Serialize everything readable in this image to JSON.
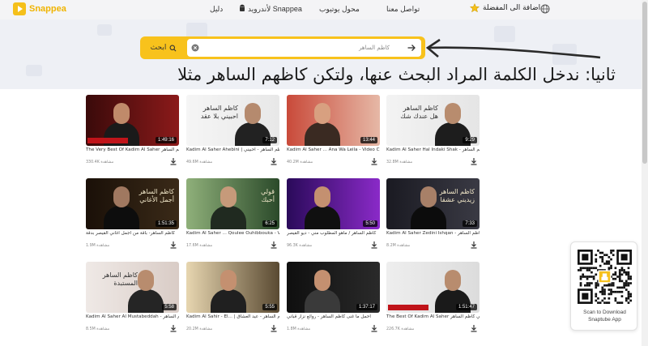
{
  "header": {
    "brand": "Snappea",
    "nav_guide": "دليل",
    "nav_android": "لأندرويد Snappea",
    "nav_converter": "محول يوتيوب",
    "nav_contact": "تواصل معنا",
    "nav_favorites": "اضافة الى المفضلة",
    "accent_color": "#f5c01b"
  },
  "search": {
    "value": "كاظم الساهر",
    "button_label": "ابحث",
    "button_icon": "search-icon",
    "clear_icon": "close-circle-icon",
    "submit_icon": "arrow-right-icon"
  },
  "annotation": "ثانيا: ندخل الكلمة المراد البحث عنها، ولتكن كاظهم الساهر مثلا",
  "videos": [
    {
      "thumb_text": "",
      "duration": "1:49:16",
      "title": "The Very Best Of Kadim Al Saher كاظم الساهر",
      "views": "330.4K مشاهدة"
    },
    {
      "thumb_text": "كاظم الساهر\nاحبيني بلا عقد",
      "duration": "7:12",
      "title": "Kadim Al Saher Ahebini | كاظم الساهر - أحبيني",
      "views": "49.6M مشاهدة"
    },
    {
      "thumb_text": "",
      "duration": "13:44",
      "title": "Kadim Al Saher ... Ana Wa Leila - Video Clip |",
      "views": "40.2M مشاهدة"
    },
    {
      "thumb_text": "كاظم الساهر\nهل عندك شك",
      "duration": "9:29",
      "title": "Kadim Al Saher Hal Indaki Shak - كاظم الساهر",
      "views": "32.8M مشاهدة"
    },
    {
      "thumb_text": "كاظم الساهر\nأجمل الأغاني",
      "duration": "1:51:35",
      "title": "كاظم الساهر- باقة من أجمل أغاني القيصر بدقة",
      "views": "1.9M مشاهدة"
    },
    {
      "thumb_text": "قولي\nأحبك",
      "duration": "6:25",
      "title": "Kadim Al Saher ... Qoulee Ouhibbouka - Vide",
      "views": "17.6M مشاهدة"
    },
    {
      "thumb_text": "",
      "duration": "5:50",
      "title": "كاظم الساهر / ماهو المطلوب مني - ديو القيصر",
      "views": "96.3K مشاهدة"
    },
    {
      "thumb_text": "كاظم الساهر\nزيديني عشقا",
      "duration": "7:33",
      "title": "Kadim Al Saher Zedini Ishqan - كاظم الساهر",
      "views": "8.2M مشاهدة"
    },
    {
      "thumb_text": "كاظم الساهر\nالمستبدة",
      "duration": "5:58",
      "title": "Kadim Al Saher Al Mustabeddah - كاظم الساهر",
      "views": "8.5M مشاهدة"
    },
    {
      "thumb_text": "",
      "duration": "5:55",
      "title": "Kadim Al Sahir - El... | كاظم الساهر - عيد العشاق",
      "views": "20.2M مشاهدة"
    },
    {
      "thumb_text": "",
      "duration": "1:37:17",
      "title": "أحمل ما غنى كاظم الساهر - روائع نزار قباني",
      "views": "1.8M مشاهدة"
    },
    {
      "thumb_text": "",
      "duration": "1:51:47",
      "title": "The Best Of Kadim Al Saher أجمل أغاني كاظم الساهر",
      "views": "226.7K مشاهدة"
    }
  ],
  "qr": {
    "line1": "Scan to Download",
    "line2": "Snaptube App"
  }
}
